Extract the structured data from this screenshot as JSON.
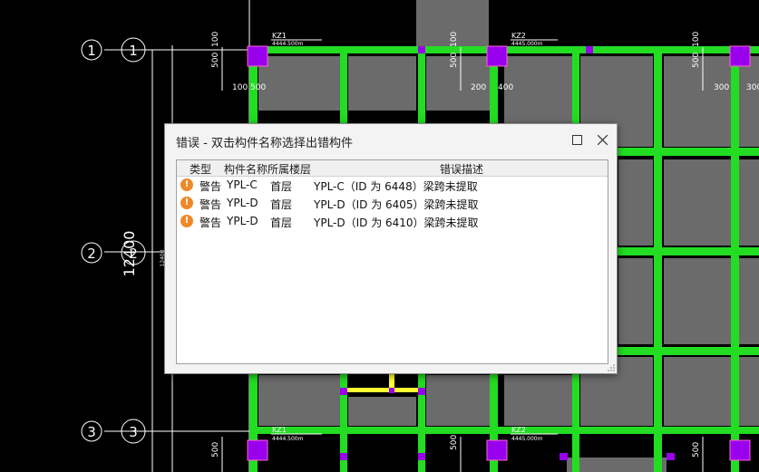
{
  "drawing": {
    "axis_labels": [
      "1",
      "2",
      "3"
    ],
    "column_tags": [
      "KZ1",
      "KZ2",
      "KZ1",
      "KZ2"
    ],
    "column_elevations": [
      "4444.500m",
      "4445.000m",
      "4444.500m",
      "4445.000m"
    ],
    "dims": {
      "d100": "100",
      "d500": "500",
      "d200": "200",
      "d400": "400",
      "d300": "300",
      "d12400": "12400",
      "d12400_small": "12400"
    }
  },
  "dialog": {
    "title": "错误 - 双击构件名称选择出错构件",
    "columns": {
      "type": "类型",
      "name": "构件名称",
      "floor": "所属楼层",
      "desc": "错误描述"
    },
    "rows": [
      {
        "type": "警告",
        "name": "YPL-C",
        "floor": "首层",
        "desc": "YPL-C（ID 为 6448）梁跨未提取"
      },
      {
        "type": "警告",
        "name": "YPL-D",
        "floor": "首层",
        "desc": "YPL-D（ID 为 6405）梁跨未提取"
      },
      {
        "type": "警告",
        "name": "YPL-D",
        "floor": "首层",
        "desc": "YPL-D（ID 为 6410）梁跨未提取"
      }
    ]
  },
  "colors": {
    "beam": "#22dd22",
    "slab": "#6b6b6b",
    "column": "#9900ee",
    "axis": "#ffffff",
    "highlight": "#ffff33",
    "warning": "#f0882a"
  },
  "icons": [
    "warning-icon",
    "maximize-icon",
    "close-icon",
    "resize-grip-icon"
  ]
}
